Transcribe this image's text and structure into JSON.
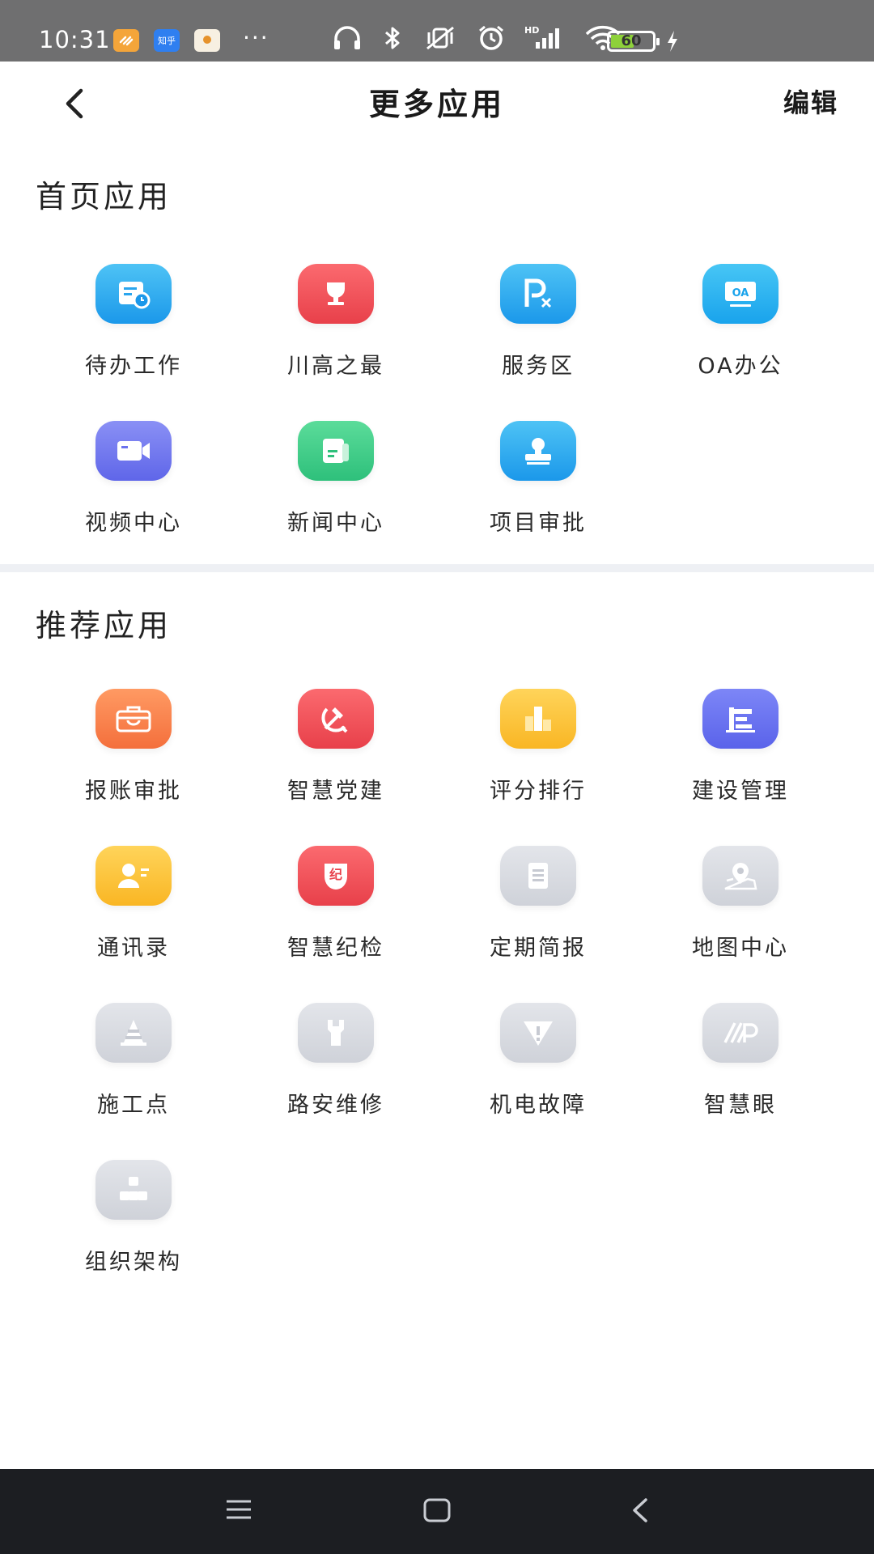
{
  "status_bar": {
    "time": "10:31",
    "app_badges": [
      "",
      "知乎",
      ""
    ],
    "more": "···",
    "battery_percent": 60,
    "battery_label": "60"
  },
  "header": {
    "title": "更多应用",
    "edit_label": "编辑"
  },
  "home_apps": {
    "title": "首页应用",
    "items": [
      {
        "label": "待办工作",
        "icon": "todo-icon",
        "color": "#1b98ea"
      },
      {
        "label": "川高之最",
        "icon": "trophy-icon",
        "color": "#e8404a"
      },
      {
        "label": "服务区",
        "icon": "parking-service-icon",
        "color": "#1b98ea"
      },
      {
        "label": "OA办公",
        "icon": "oa-office-icon",
        "color": "#19a3ec"
      },
      {
        "label": "视频中心",
        "icon": "video-camera-icon",
        "color": "#5f66e9"
      },
      {
        "label": "新闻中心",
        "icon": "news-icon",
        "color": "#2ec07b"
      },
      {
        "label": "项目审批",
        "icon": "stamp-icon",
        "color": "#1b98ea"
      }
    ]
  },
  "recommended_apps": {
    "title": "推荐应用",
    "items": [
      {
        "label": "报账审批",
        "icon": "briefcase-icon",
        "color": "#f46f3c"
      },
      {
        "label": "智慧党建",
        "icon": "party-emblem-icon",
        "color": "#e8404a"
      },
      {
        "label": "评分排行",
        "icon": "bar-ranking-icon",
        "color": "#f9b624"
      },
      {
        "label": "建设管理",
        "icon": "construction-icon",
        "color": "#5a63ea"
      },
      {
        "label": "通讯录",
        "icon": "contact-card-icon",
        "color": "#f9b624"
      },
      {
        "label": "智慧纪检",
        "icon": "discipline-shield-icon",
        "color": "#e8404a",
        "glyph": "纪"
      },
      {
        "label": "定期简报",
        "icon": "document-icon",
        "color": "#cfd2d9"
      },
      {
        "label": "地图中心",
        "icon": "map-pin-icon",
        "color": "#cfd2d9"
      },
      {
        "label": "施工点",
        "icon": "traffic-cone-icon",
        "color": "#cfd2d9"
      },
      {
        "label": "路安维修",
        "icon": "wrench-icon",
        "color": "#cfd2d9"
      },
      {
        "label": "机电故障",
        "icon": "warning-icon",
        "color": "#cfd2d9"
      },
      {
        "label": "智慧眼",
        "icon": "smart-eye-logo-icon",
        "color": "#cfd2d9"
      },
      {
        "label": "组织架构",
        "icon": "org-chart-icon",
        "color": "#cfd2d9"
      }
    ]
  },
  "nav_bar": {
    "menu": "menu-icon",
    "home": "home-square-icon",
    "back": "back-triangle-icon"
  }
}
